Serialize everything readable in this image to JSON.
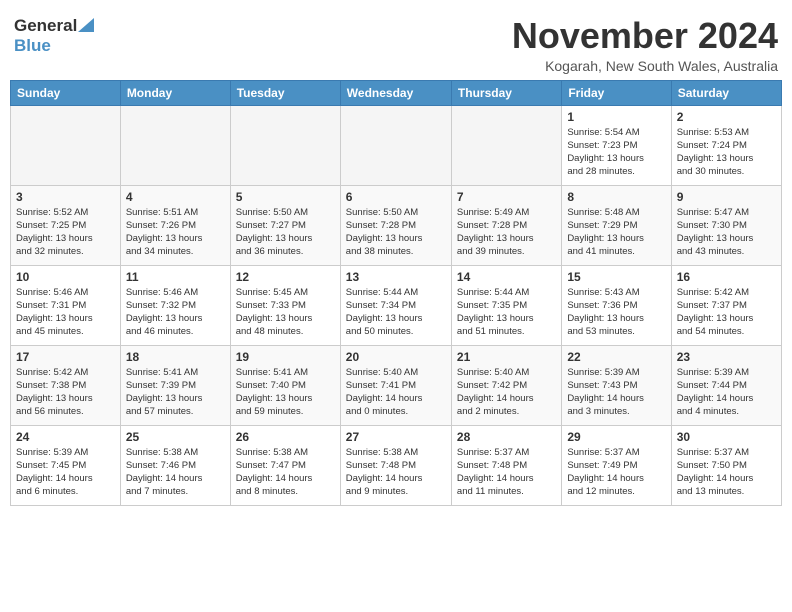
{
  "header": {
    "logo_general": "General",
    "logo_blue": "Blue",
    "month_title": "November 2024",
    "location": "Kogarah, New South Wales, Australia"
  },
  "calendar": {
    "days_of_week": [
      "Sunday",
      "Monday",
      "Tuesday",
      "Wednesday",
      "Thursday",
      "Friday",
      "Saturday"
    ],
    "weeks": [
      [
        {
          "day": "",
          "info": ""
        },
        {
          "day": "",
          "info": ""
        },
        {
          "day": "",
          "info": ""
        },
        {
          "day": "",
          "info": ""
        },
        {
          "day": "",
          "info": ""
        },
        {
          "day": "1",
          "info": "Sunrise: 5:54 AM\nSunset: 7:23 PM\nDaylight: 13 hours\nand 28 minutes."
        },
        {
          "day": "2",
          "info": "Sunrise: 5:53 AM\nSunset: 7:24 PM\nDaylight: 13 hours\nand 30 minutes."
        }
      ],
      [
        {
          "day": "3",
          "info": "Sunrise: 5:52 AM\nSunset: 7:25 PM\nDaylight: 13 hours\nand 32 minutes."
        },
        {
          "day": "4",
          "info": "Sunrise: 5:51 AM\nSunset: 7:26 PM\nDaylight: 13 hours\nand 34 minutes."
        },
        {
          "day": "5",
          "info": "Sunrise: 5:50 AM\nSunset: 7:27 PM\nDaylight: 13 hours\nand 36 minutes."
        },
        {
          "day": "6",
          "info": "Sunrise: 5:50 AM\nSunset: 7:28 PM\nDaylight: 13 hours\nand 38 minutes."
        },
        {
          "day": "7",
          "info": "Sunrise: 5:49 AM\nSunset: 7:28 PM\nDaylight: 13 hours\nand 39 minutes."
        },
        {
          "day": "8",
          "info": "Sunrise: 5:48 AM\nSunset: 7:29 PM\nDaylight: 13 hours\nand 41 minutes."
        },
        {
          "day": "9",
          "info": "Sunrise: 5:47 AM\nSunset: 7:30 PM\nDaylight: 13 hours\nand 43 minutes."
        }
      ],
      [
        {
          "day": "10",
          "info": "Sunrise: 5:46 AM\nSunset: 7:31 PM\nDaylight: 13 hours\nand 45 minutes."
        },
        {
          "day": "11",
          "info": "Sunrise: 5:46 AM\nSunset: 7:32 PM\nDaylight: 13 hours\nand 46 minutes."
        },
        {
          "day": "12",
          "info": "Sunrise: 5:45 AM\nSunset: 7:33 PM\nDaylight: 13 hours\nand 48 minutes."
        },
        {
          "day": "13",
          "info": "Sunrise: 5:44 AM\nSunset: 7:34 PM\nDaylight: 13 hours\nand 50 minutes."
        },
        {
          "day": "14",
          "info": "Sunrise: 5:44 AM\nSunset: 7:35 PM\nDaylight: 13 hours\nand 51 minutes."
        },
        {
          "day": "15",
          "info": "Sunrise: 5:43 AM\nSunset: 7:36 PM\nDaylight: 13 hours\nand 53 minutes."
        },
        {
          "day": "16",
          "info": "Sunrise: 5:42 AM\nSunset: 7:37 PM\nDaylight: 13 hours\nand 54 minutes."
        }
      ],
      [
        {
          "day": "17",
          "info": "Sunrise: 5:42 AM\nSunset: 7:38 PM\nDaylight: 13 hours\nand 56 minutes."
        },
        {
          "day": "18",
          "info": "Sunrise: 5:41 AM\nSunset: 7:39 PM\nDaylight: 13 hours\nand 57 minutes."
        },
        {
          "day": "19",
          "info": "Sunrise: 5:41 AM\nSunset: 7:40 PM\nDaylight: 13 hours\nand 59 minutes."
        },
        {
          "day": "20",
          "info": "Sunrise: 5:40 AM\nSunset: 7:41 PM\nDaylight: 14 hours\nand 0 minutes."
        },
        {
          "day": "21",
          "info": "Sunrise: 5:40 AM\nSunset: 7:42 PM\nDaylight: 14 hours\nand 2 minutes."
        },
        {
          "day": "22",
          "info": "Sunrise: 5:39 AM\nSunset: 7:43 PM\nDaylight: 14 hours\nand 3 minutes."
        },
        {
          "day": "23",
          "info": "Sunrise: 5:39 AM\nSunset: 7:44 PM\nDaylight: 14 hours\nand 4 minutes."
        }
      ],
      [
        {
          "day": "24",
          "info": "Sunrise: 5:39 AM\nSunset: 7:45 PM\nDaylight: 14 hours\nand 6 minutes."
        },
        {
          "day": "25",
          "info": "Sunrise: 5:38 AM\nSunset: 7:46 PM\nDaylight: 14 hours\nand 7 minutes."
        },
        {
          "day": "26",
          "info": "Sunrise: 5:38 AM\nSunset: 7:47 PM\nDaylight: 14 hours\nand 8 minutes."
        },
        {
          "day": "27",
          "info": "Sunrise: 5:38 AM\nSunset: 7:48 PM\nDaylight: 14 hours\nand 9 minutes."
        },
        {
          "day": "28",
          "info": "Sunrise: 5:37 AM\nSunset: 7:48 PM\nDaylight: 14 hours\nand 11 minutes."
        },
        {
          "day": "29",
          "info": "Sunrise: 5:37 AM\nSunset: 7:49 PM\nDaylight: 14 hours\nand 12 minutes."
        },
        {
          "day": "30",
          "info": "Sunrise: 5:37 AM\nSunset: 7:50 PM\nDaylight: 14 hours\nand 13 minutes."
        }
      ]
    ]
  }
}
